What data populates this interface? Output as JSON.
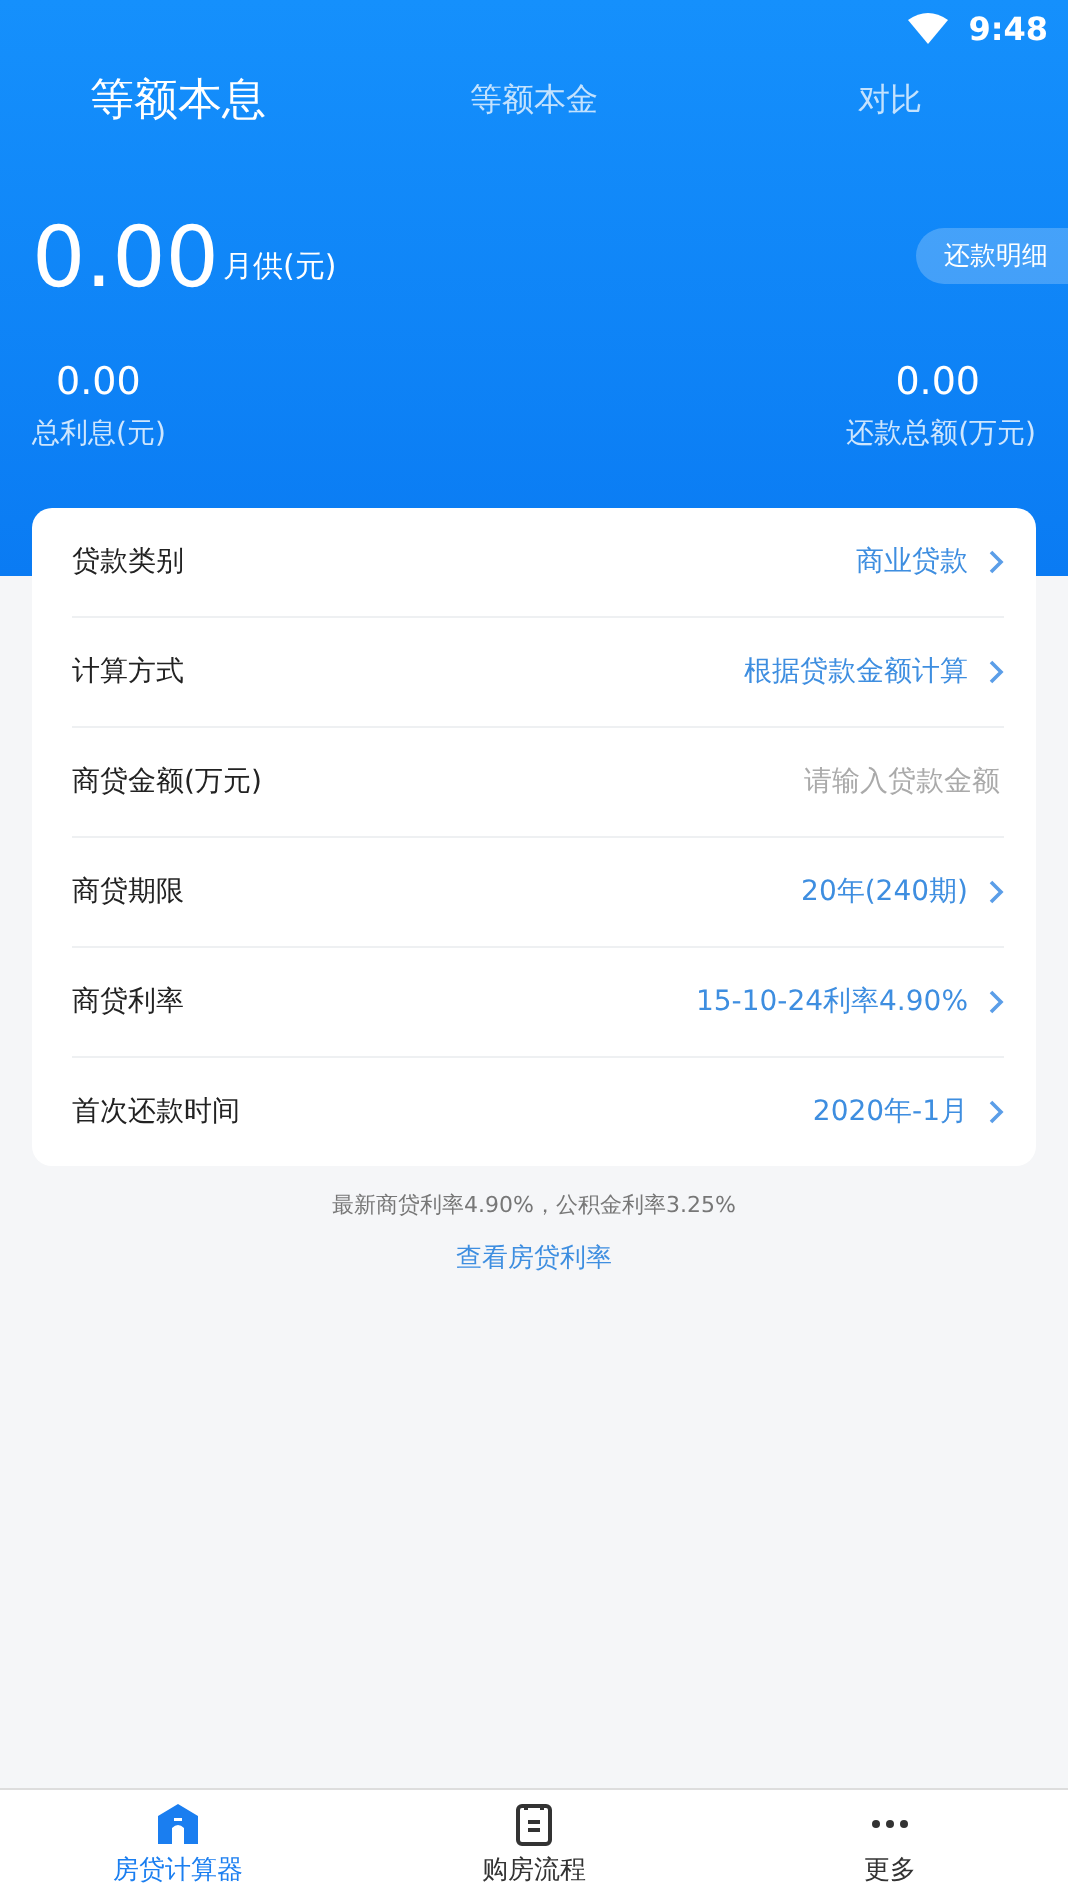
{
  "status_bar": {
    "time": "9:48"
  },
  "tabs": [
    {
      "label": "等额本息",
      "selected": true
    },
    {
      "label": "等额本金",
      "selected": false
    },
    {
      "label": "对比",
      "selected": false
    }
  ],
  "summary": {
    "monthly_value": "0.00",
    "monthly_label": "月供(元)",
    "detail_button": "还款明细",
    "interest_value": "0.00",
    "interest_label": "总利息(元)",
    "total_value": "0.00",
    "total_label": "还款总额(万元)"
  },
  "form": [
    {
      "kind": "select",
      "label": "贷款类别",
      "value": "商业贷款"
    },
    {
      "kind": "select",
      "label": "计算方式",
      "value": "根据贷款金额计算"
    },
    {
      "kind": "input",
      "label": "商贷金额(万元)",
      "placeholder": "请输入贷款金额"
    },
    {
      "kind": "select",
      "label": "商贷期限",
      "value": "20年(240期)"
    },
    {
      "kind": "select",
      "label": "商贷利率",
      "value": "15-10-24利率4.90%"
    },
    {
      "kind": "select",
      "label": "首次还款时间",
      "value": "2020年-1月"
    }
  ],
  "note": "最新商贷利率4.90%，公积金利率3.25%",
  "link": "查看房贷利率",
  "bottom_nav": [
    {
      "label": "房贷计算器",
      "selected": true
    },
    {
      "label": "购房流程",
      "selected": false
    },
    {
      "label": "更多",
      "selected": false
    }
  ]
}
